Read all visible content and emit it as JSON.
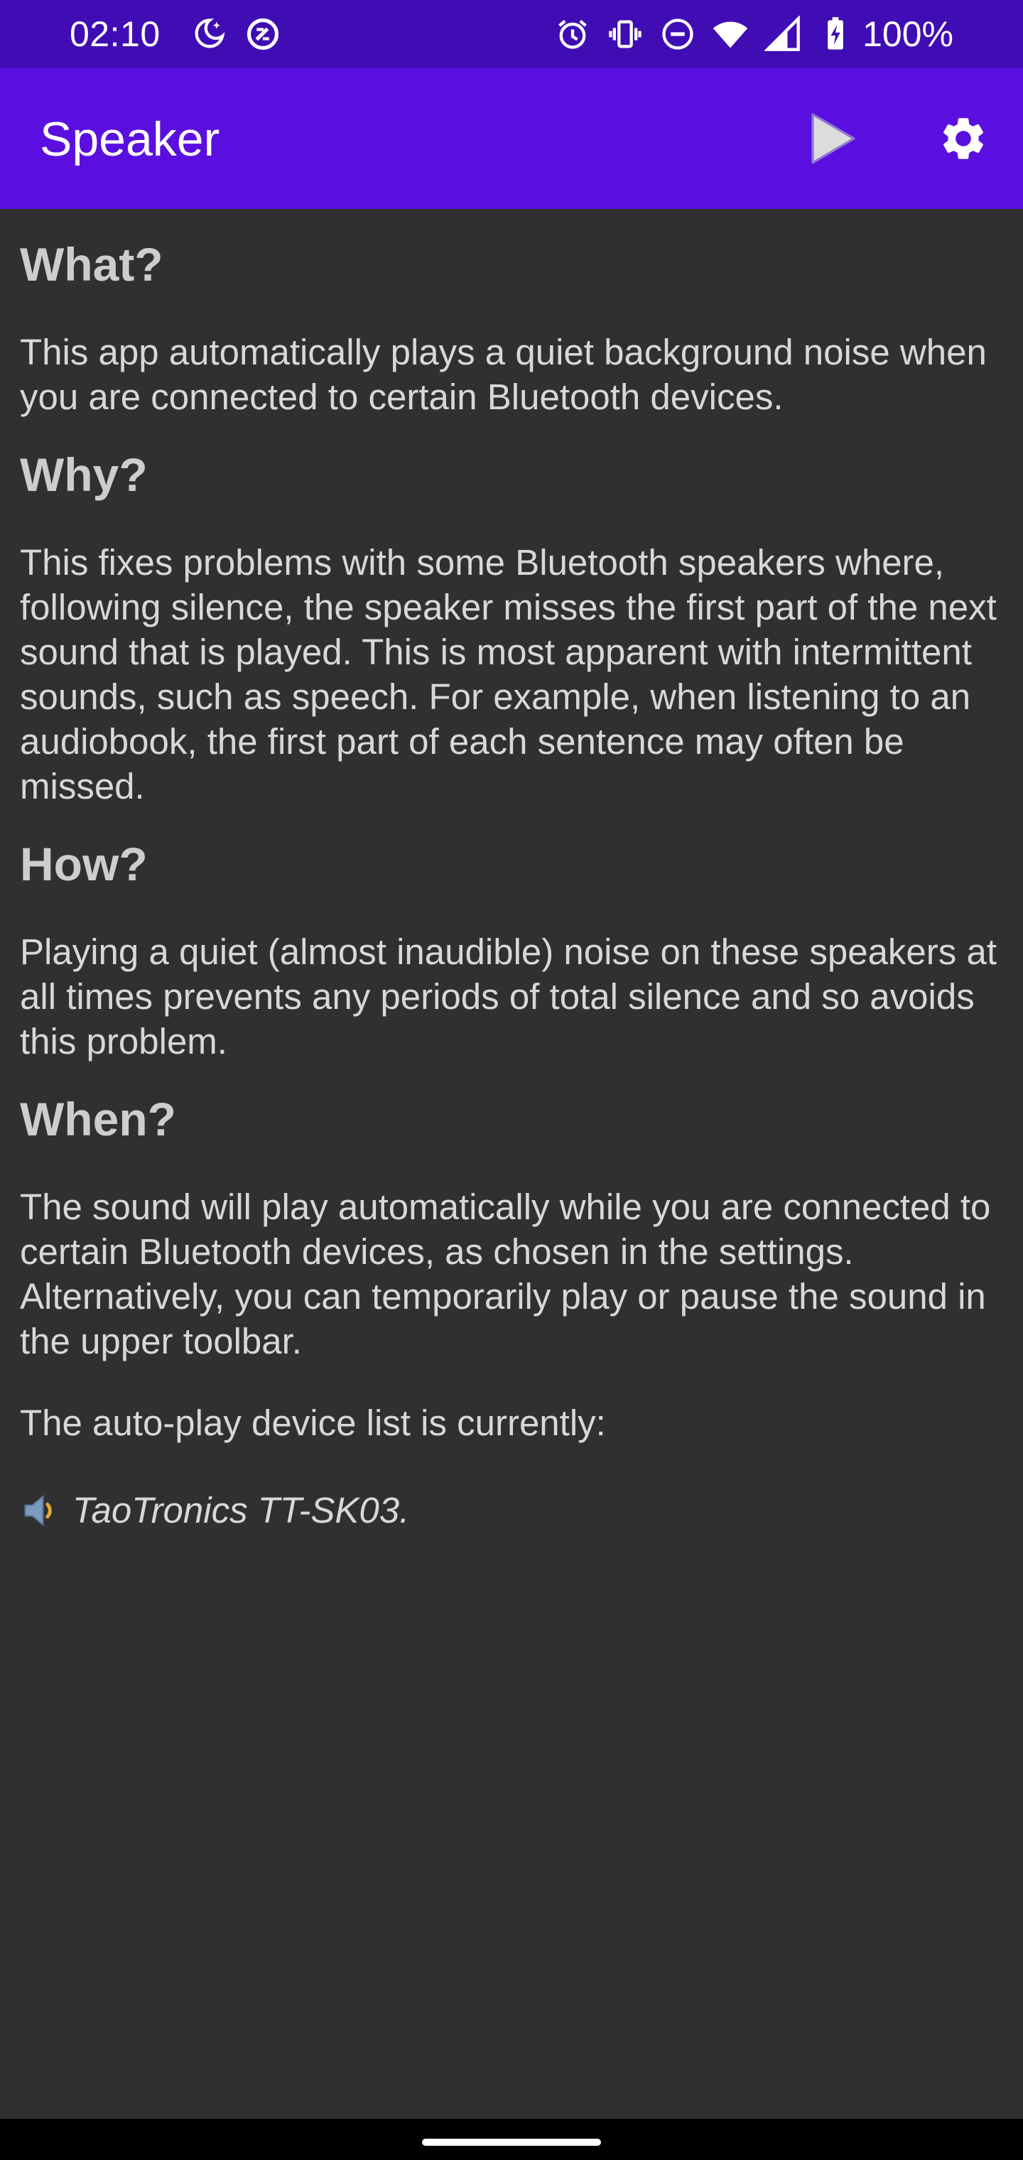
{
  "status_bar": {
    "time": "02:10",
    "battery_text": "100%",
    "left_icons": [
      "bedtime-moon-icon",
      "data-saver-icon"
    ],
    "right_icons": [
      "alarm-icon",
      "vibrate-icon",
      "do-not-disturb-icon",
      "wifi-icon",
      "cell-signal-icon",
      "battery-charging-icon"
    ]
  },
  "app_bar": {
    "title": "Speaker",
    "actions": [
      {
        "icon": "play-icon"
      },
      {
        "icon": "gear-icon"
      }
    ]
  },
  "colors": {
    "status_bar_bg": "#3f0db3",
    "app_bar_bg": "#5a0fe0",
    "page_bg": "#303030",
    "text": "#d8d8d8"
  },
  "sections": [
    {
      "heading": "What?",
      "body": "This app automatically plays a quiet background noise when you are connected to certain Bluetooth devices."
    },
    {
      "heading": "Why?",
      "body": "This fixes problems with some Bluetooth speakers where, following silence, the speaker misses the first part of the next sound that is played. This is most apparent with intermittent sounds, such as speech. For example, when listening to an audiobook, the first part of each sentence may often be missed."
    },
    {
      "heading": "How?",
      "body": "Playing a quiet (almost inaudible) noise on these speakers at all times prevents any periods of total silence and so avoids this problem."
    },
    {
      "heading": "When?",
      "body": "The sound will play automatically while you are connected to certain Bluetooth devices, as chosen in the settings. Alternatively, you can temporarily play or pause the sound in the upper toolbar."
    }
  ],
  "device_list": {
    "intro": "The auto-play device list is currently:",
    "icon": "speaker-icon",
    "device": "TaoTronics TT-SK03."
  }
}
